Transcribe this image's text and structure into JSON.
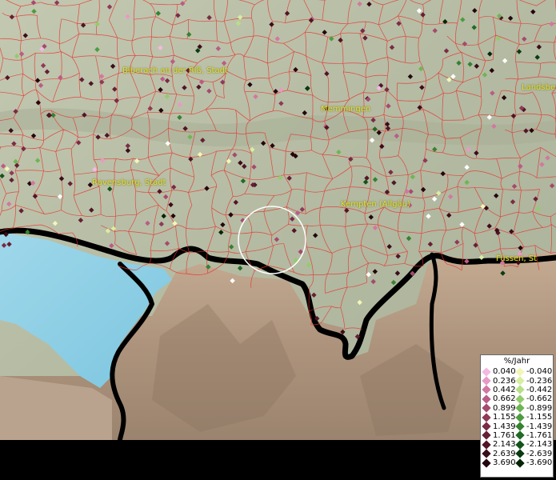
{
  "map": {
    "places": [
      {
        "name": "Biberach an der Riß, Stadt"
      },
      {
        "name": "Landsberg"
      },
      {
        "name": "Memmingen"
      },
      {
        "name": "Ravensburg, Stadt"
      },
      {
        "name": "Kempten (Allgäu)"
      },
      {
        "name": "Füssen, St"
      }
    ]
  },
  "legend": {
    "title": "%/Jahr",
    "positive": [
      {
        "label": "0.040",
        "color": "#f4b8e4"
      },
      {
        "label": "0.236",
        "color": "#e89ac6"
      },
      {
        "label": "0.442",
        "color": "#d277a2"
      },
      {
        "label": "0.662",
        "color": "#bb5c86"
      },
      {
        "label": "0.899",
        "color": "#a54a6e"
      },
      {
        "label": "1.155",
        "color": "#8e3a59"
      },
      {
        "label": "1.439",
        "color": "#7a2b45"
      },
      {
        "label": "1.761",
        "color": "#661f35"
      },
      {
        "label": "2.143",
        "color": "#511527"
      },
      {
        "label": "2.639",
        "color": "#3b0c1a"
      },
      {
        "label": "3.690",
        "color": "#24050e"
      }
    ],
    "negative": [
      {
        "label": "-0.040",
        "color": "#f2f7b8"
      },
      {
        "label": "-0.236",
        "color": "#d8eea0"
      },
      {
        "label": "-0.442",
        "color": "#b8df88"
      },
      {
        "label": "-0.662",
        "color": "#93cc6c"
      },
      {
        "label": "-0.899",
        "color": "#6fb554"
      },
      {
        "label": "-1.155",
        "color": "#4e9c40"
      },
      {
        "label": "-1.439",
        "color": "#358231"
      },
      {
        "label": "-1.761",
        "color": "#226a25"
      },
      {
        "label": "-2.143",
        "color": "#13531a"
      },
      {
        "label": "-2.639",
        "color": "#083c10"
      },
      {
        "label": "-3.690",
        "color": "#022507"
      }
    ]
  },
  "colors": {
    "boundary": "#e8312f",
    "highlight_ring": "#ffffff",
    "label": "#e2e02a",
    "no_change": "#ffffff"
  }
}
